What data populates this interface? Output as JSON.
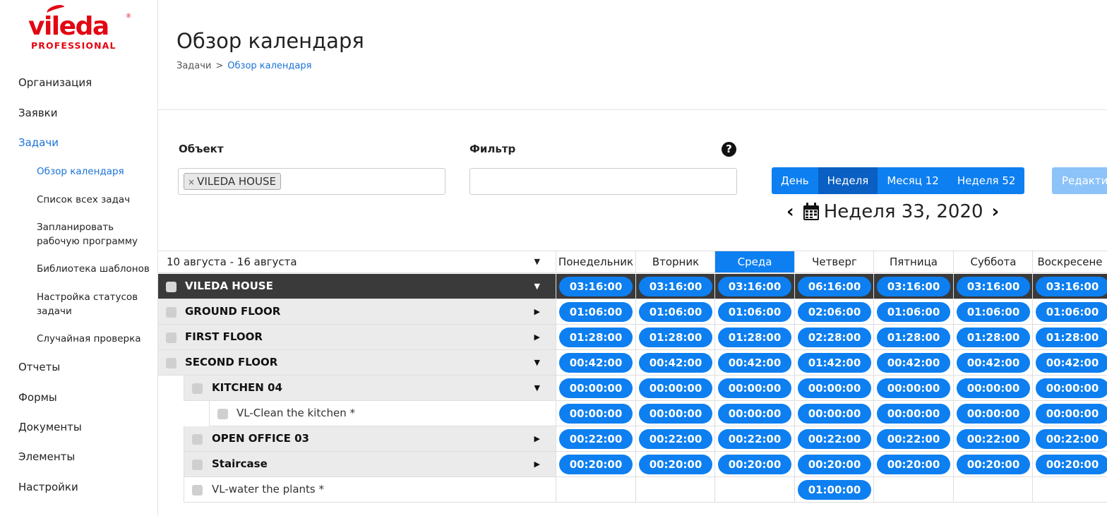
{
  "logo": {
    "brand": "vileda",
    "sub": "PROFESSIONAL",
    "reg": "®"
  },
  "nav": {
    "items": [
      {
        "label": "Организация"
      },
      {
        "label": "Заявки"
      },
      {
        "label": "Задачи"
      },
      {
        "label": "Отчеты"
      },
      {
        "label": "Формы"
      },
      {
        "label": "Документы"
      },
      {
        "label": "Элементы"
      },
      {
        "label": "Настройки"
      }
    ],
    "sub_items": [
      {
        "label": "Обзор календаря"
      },
      {
        "label": "Список всех задач"
      },
      {
        "label": "Запланировать рабочую программу"
      },
      {
        "label": "Библиотека шаблонов"
      },
      {
        "label": "Настройка статусов задачи"
      },
      {
        "label": "Случайная проверка"
      }
    ]
  },
  "header": {
    "title": "Обзор календаря",
    "breadcrumb": {
      "parent": "Задачи",
      "separator": ">",
      "current": "Обзор календаря"
    }
  },
  "filters": {
    "object_label": "Объект",
    "object_tag": "VILEDA HOUSE",
    "object_tag_remove": "×",
    "filter_label": "Фильтр",
    "filter_value": "",
    "help": "?"
  },
  "views": {
    "buttons": [
      {
        "label": "День"
      },
      {
        "label": "Неделя"
      },
      {
        "label": "Месяц 12"
      },
      {
        "label": "Неделя 52"
      }
    ],
    "active": "Неделя",
    "edit_label": "Редактир"
  },
  "week_nav": {
    "title": "Неделя 33, 2020",
    "prev": "‹",
    "next": "›"
  },
  "table": {
    "range": "10 августа - 16 августа",
    "days": [
      "Понедельник",
      "Вторник",
      "Среда",
      "Четверг",
      "Пятница",
      "Суббота",
      "Воскресене"
    ],
    "active_day": "Среда",
    "rows": [
      {
        "name": "VILEDA HOUSE",
        "level": 0,
        "toggle": "▼",
        "times": [
          "03:16:00",
          "03:16:00",
          "03:16:00",
          "06:16:00",
          "03:16:00",
          "03:16:00",
          "03:16:00"
        ]
      },
      {
        "name": "GROUND FLOOR",
        "level": 0,
        "toggle": "▶",
        "times": [
          "01:06:00",
          "01:06:00",
          "01:06:00",
          "02:06:00",
          "01:06:00",
          "01:06:00",
          "01:06:00"
        ]
      },
      {
        "name": "FIRST FLOOR",
        "level": 0,
        "toggle": "▶",
        "times": [
          "01:28:00",
          "01:28:00",
          "01:28:00",
          "02:28:00",
          "01:28:00",
          "01:28:00",
          "01:28:00"
        ]
      },
      {
        "name": "SECOND FLOOR",
        "level": 0,
        "toggle": "▼",
        "times": [
          "00:42:00",
          "00:42:00",
          "00:42:00",
          "01:42:00",
          "00:42:00",
          "00:42:00",
          "00:42:00"
        ]
      },
      {
        "name": "KITCHEN 04",
        "level": 1,
        "toggle": "▼",
        "times": [
          "00:00:00",
          "00:00:00",
          "00:00:00",
          "00:00:00",
          "00:00:00",
          "00:00:00",
          "00:00:00"
        ]
      },
      {
        "name": "VL-Clean the kitchen *",
        "level": 2,
        "toggle": "",
        "times": [
          "00:00:00",
          "00:00:00",
          "00:00:00",
          "00:00:00",
          "00:00:00",
          "00:00:00",
          "00:00:00"
        ]
      },
      {
        "name": "OPEN OFFICE 03",
        "level": 1,
        "toggle": "▶",
        "times": [
          "00:22:00",
          "00:22:00",
          "00:22:00",
          "00:22:00",
          "00:22:00",
          "00:22:00",
          "00:22:00"
        ]
      },
      {
        "name": "Staircase",
        "level": 1,
        "toggle": "▶",
        "times": [
          "00:20:00",
          "00:20:00",
          "00:20:00",
          "00:20:00",
          "00:20:00",
          "00:20:00",
          "00:20:00"
        ]
      },
      {
        "name": "VL-water the plants *",
        "level": 1,
        "toggle": "",
        "times": [
          "",
          "",
          "",
          "01:00:00",
          "",
          "",
          ""
        ]
      }
    ]
  },
  "colors": {
    "accent": "#0d7ff0",
    "accent_dark": "#0a5fc2",
    "brand": "#e30613",
    "header_row": "#3a3a3a",
    "group_row": "#ebebeb"
  }
}
